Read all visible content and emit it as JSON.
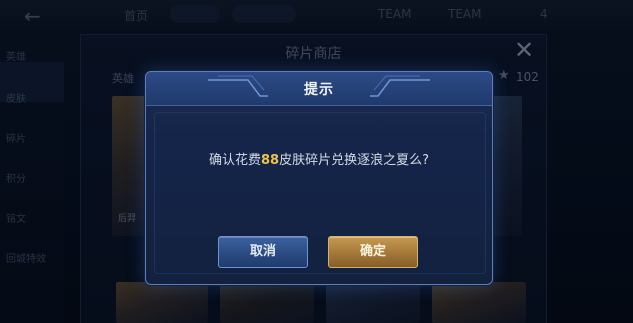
{
  "background": {
    "top_bar": {
      "back_icon": "back-arrow-icon",
      "text_items": [
        "首页",
        "TEAM",
        "TEAM",
        "4"
      ]
    },
    "side_nav": [
      "英雄",
      "皮肤",
      "碎片",
      "积分",
      "铭文",
      "回城特效"
    ],
    "shop": {
      "title": "碎片商店",
      "tab_label": "英雄",
      "fragment_count": "102",
      "card_label": "后羿",
      "close_icon": "close-icon",
      "star_icon": "star-icon"
    }
  },
  "dialog": {
    "title": "提示",
    "message_prefix": "确认花费",
    "cost": "88",
    "message_suffix": "皮肤碎片兑换逐浪之夏么?",
    "cancel_label": "取消",
    "confirm_label": "确定"
  },
  "colors": {
    "highlight": "#f0c04a",
    "dialog_border": "#5a7fc0",
    "confirm_button": "#a37838",
    "cancel_button": "#2b4b82"
  }
}
